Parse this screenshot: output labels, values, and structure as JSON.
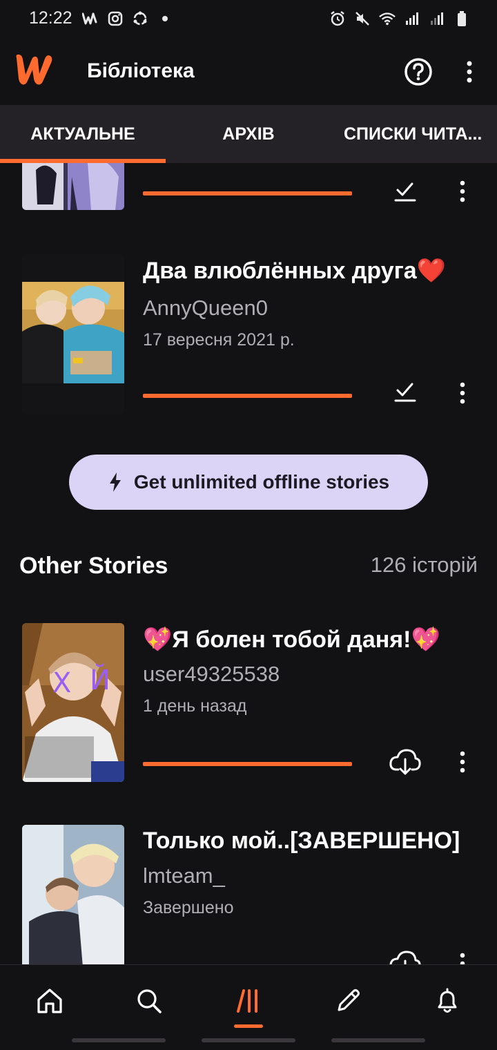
{
  "status_bar": {
    "time": "12:22",
    "left_icons": [
      "wattpad-icon",
      "instagram-icon",
      "sync-icon",
      "dot-icon"
    ],
    "right_icons": [
      "alarm-icon",
      "mute-icon",
      "wifi-icon",
      "signal-icon",
      "signal-icon",
      "battery-icon"
    ]
  },
  "app_bar": {
    "title": "Бібліотека",
    "brand_color": "#ff6a2f"
  },
  "tabs": [
    {
      "label": "АКТУАЛЬНЕ",
      "active": true
    },
    {
      "label": "АРХІВ",
      "active": false
    },
    {
      "label": "СПИСКИ ЧИТА..."
    }
  ],
  "stories_current": [
    {
      "title": "",
      "author": "",
      "meta": "",
      "action": "checkmark-icon",
      "progress": 1.0
    },
    {
      "title": "Два влюблённых друга❤️",
      "author": "AnnyQueen0",
      "meta": "17 вересня 2021 р.",
      "action": "checkmark-icon",
      "progress": 1.0
    }
  ],
  "promo": {
    "icon": "lightning-icon",
    "label": "Get unlimited offline stories"
  },
  "other_section": {
    "title": "Other Stories",
    "count": "126 історій"
  },
  "stories_other": [
    {
      "title": "💖Я болен тобой даня!💖",
      "author": "user49325538",
      "meta": "1 день назад",
      "action": "download-cloud-icon",
      "progress": 1.0,
      "cover_text": [
        "Х",
        "Й"
      ]
    },
    {
      "title": "Только мой..[ЗАВЕРШЕНО]",
      "author": "lmteam_",
      "meta": "Завершено",
      "action": "download-cloud-icon"
    }
  ],
  "bottom_nav": [
    {
      "icon": "home-icon",
      "active": false
    },
    {
      "icon": "search-icon",
      "active": false
    },
    {
      "icon": "library-icon",
      "active": true
    },
    {
      "icon": "pencil-icon",
      "active": false
    },
    {
      "icon": "bell-icon",
      "active": false
    }
  ]
}
